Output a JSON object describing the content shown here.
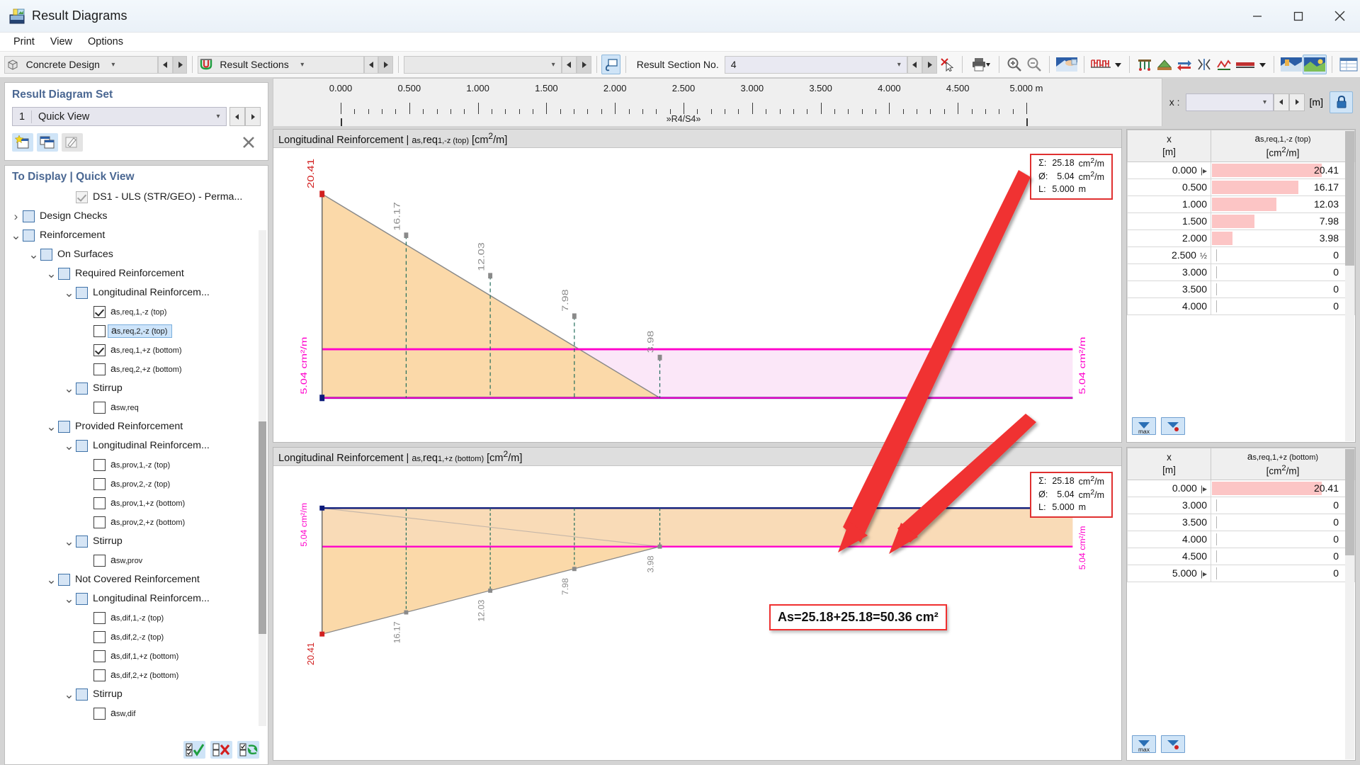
{
  "window": {
    "title": "Result Diagrams",
    "icon": "result-diagrams-icon",
    "minimize": "minimize",
    "maximize": "maximize",
    "close": "close"
  },
  "menu": {
    "items": [
      "Print",
      "View",
      "Options"
    ]
  },
  "toolbar": {
    "design_combo": {
      "value": "Concrete Design",
      "icon": "cube-icon"
    },
    "sections_combo": {
      "value": "Result Sections",
      "icon": "section-icon"
    },
    "empty_combo": {
      "value": ""
    },
    "snapshot_button": "snapshot",
    "result_section_label": "Result Section No.",
    "result_section_value": "4",
    "delete_button": "delete-cursor",
    "print_button": "print",
    "zoom_in_button": "zoom-in",
    "zoom_out_button": "zoom-out",
    "render_button": "render-view",
    "diagram_button": "diagram-style",
    "icons": [
      "result-values",
      "surface-results",
      "exchange",
      "scale",
      "line-style",
      "members",
      "solids",
      "table-view"
    ]
  },
  "xcontrol": {
    "label": "x :",
    "value": "",
    "unit": "[m]",
    "lock": "lock-icon"
  },
  "ruler": {
    "ticks": [
      "0.000",
      "0.500",
      "1.000",
      "1.500",
      "2.000",
      "2.500",
      "3.000",
      "3.500",
      "4.000",
      "4.500",
      "5.000 m"
    ],
    "section_label": "»R4/S4»"
  },
  "sidebar": {
    "set_header": "Result Diagram Set",
    "set_number": "1",
    "set_name": "Quick View",
    "set_buttons": [
      "new-set-icon",
      "copy-set-icon",
      "edit-set-icon",
      "close-icon"
    ],
    "display_header": "To Display | Quick View",
    "tree": [
      {
        "indent": 3,
        "twist": "",
        "box": "gray-checked",
        "label": "DS1 - ULS (STR/GEO) - Perma...",
        "sel": false
      },
      {
        "indent": 0,
        "twist": "right",
        "box": "parent",
        "label": "Design Checks",
        "sel": false
      },
      {
        "indent": 0,
        "twist": "down",
        "box": "parent",
        "label": "Reinforcement",
        "sel": false
      },
      {
        "indent": 1,
        "twist": "down",
        "box": "parent",
        "label": "On Surfaces",
        "sel": false
      },
      {
        "indent": 2,
        "twist": "down",
        "box": "parent",
        "label": "Required Reinforcement",
        "sel": false
      },
      {
        "indent": 3,
        "twist": "down",
        "box": "parent",
        "label": "Longitudinal Reinforcem...",
        "sel": false
      },
      {
        "indent": 4,
        "twist": "",
        "box": "leaf-checked",
        "label": "as,req,1,-z (top)",
        "sel": false
      },
      {
        "indent": 4,
        "twist": "",
        "box": "leaf",
        "label": "as,req,2,-z (top)",
        "sel": true
      },
      {
        "indent": 4,
        "twist": "",
        "box": "leaf-checked",
        "label": "as,req,1,+z (bottom)",
        "sel": false
      },
      {
        "indent": 4,
        "twist": "",
        "box": "leaf",
        "label": "as,req,2,+z (bottom)",
        "sel": false
      },
      {
        "indent": 3,
        "twist": "down",
        "box": "parent",
        "label": "Stirrup",
        "sel": false
      },
      {
        "indent": 4,
        "twist": "",
        "box": "leaf",
        "label": "asw,req",
        "sel": false
      },
      {
        "indent": 2,
        "twist": "down",
        "box": "parent",
        "label": "Provided Reinforcement",
        "sel": false
      },
      {
        "indent": 3,
        "twist": "down",
        "box": "parent",
        "label": "Longitudinal Reinforcem...",
        "sel": false
      },
      {
        "indent": 4,
        "twist": "",
        "box": "leaf",
        "label": "as,prov,1,-z (top)",
        "sel": false
      },
      {
        "indent": 4,
        "twist": "",
        "box": "leaf",
        "label": "as,prov,2,-z (top)",
        "sel": false
      },
      {
        "indent": 4,
        "twist": "",
        "box": "leaf",
        "label": "as,prov,1,+z (bottom)",
        "sel": false
      },
      {
        "indent": 4,
        "twist": "",
        "box": "leaf",
        "label": "as,prov,2,+z (bottom)",
        "sel": false
      },
      {
        "indent": 3,
        "twist": "down",
        "box": "parent",
        "label": "Stirrup",
        "sel": false
      },
      {
        "indent": 4,
        "twist": "",
        "box": "leaf",
        "label": "asw,prov",
        "sel": false
      },
      {
        "indent": 2,
        "twist": "down",
        "box": "parent",
        "label": "Not Covered Reinforcement",
        "sel": false
      },
      {
        "indent": 3,
        "twist": "down",
        "box": "parent",
        "label": "Longitudinal Reinforcem...",
        "sel": false
      },
      {
        "indent": 4,
        "twist": "",
        "box": "leaf",
        "label": "as,dif,1,-z (top)",
        "sel": false
      },
      {
        "indent": 4,
        "twist": "",
        "box": "leaf",
        "label": "as,dif,2,-z (top)",
        "sel": false
      },
      {
        "indent": 4,
        "twist": "",
        "box": "leaf",
        "label": "as,dif,1,+z (bottom)",
        "sel": false
      },
      {
        "indent": 4,
        "twist": "",
        "box": "leaf",
        "label": "as,dif,2,+z (bottom)",
        "sel": false
      },
      {
        "indent": 3,
        "twist": "down",
        "box": "parent",
        "label": "Stirrup",
        "sel": false
      },
      {
        "indent": 4,
        "twist": "",
        "box": "leaf",
        "label": "asw,dif",
        "sel": false
      }
    ],
    "footer_buttons": [
      "select-all-icon",
      "deselect-all-icon",
      "invert-selection-icon"
    ]
  },
  "annotation": {
    "text": "As=25.18+25.18=50.36 cm²"
  },
  "colors": {
    "accent": "#4a6792",
    "diagram_fill": "#fbd9a9",
    "cover_fill": "#fbe3f6",
    "provided_line": "#ff00cc",
    "top_line": "#001a8c",
    "peak_red": "#d22020",
    "annot_red": "#f03030",
    "bar_pink": "#fcc5c5"
  },
  "chart_data": [
    {
      "type": "area",
      "title": "Longitudinal Reinforcement | as,req,1,-z (top) [cm2/m]",
      "xlabel": "x [m]",
      "ylabel": "as,req,1,-z (top) [cm2/m]",
      "x": [
        0.0,
        0.5,
        1.0,
        1.5,
        2.0,
        2.5,
        3.0,
        3.5,
        4.0,
        4.5,
        5.0
      ],
      "values": [
        20.41,
        16.17,
        12.03,
        7.98,
        3.98,
        0,
        0,
        0,
        0,
        0,
        0
      ],
      "labeled_points": [
        "20.41",
        "16.17",
        "12.03",
        "7.98",
        "3.98"
      ],
      "max_value": 20.41,
      "provided_level": 5.04,
      "provided_label": "5.04 cm2/m",
      "peak_label": "20.41",
      "xlim": [
        0,
        5
      ],
      "legend": {
        "sum_key": "Σ:",
        "sum_value": "25.18",
        "sum_unit": "cm2/m",
        "avg_key": "Ø:",
        "avg_value": "5.04",
        "avg_unit": "cm2/m",
        "len_key": "L:",
        "len_value": "5.000",
        "len_unit": "m"
      }
    },
    {
      "type": "area",
      "title": "Longitudinal Reinforcement | as,req,1,+z (bottom) [cm2/m]",
      "xlabel": "x [m]",
      "ylabel": "as,req,1,+z (bottom) [cm2/m]",
      "x": [
        0.0,
        0.5,
        1.0,
        1.5,
        2.0,
        2.5,
        3.0,
        3.5,
        4.0,
        4.5,
        5.0
      ],
      "values": [
        20.41,
        16.17,
        12.03,
        7.98,
        3.98,
        0,
        0,
        0,
        0,
        0,
        0
      ],
      "labeled_points": [
        "20.41",
        "16.17",
        "12.03",
        "7.98",
        "3.98"
      ],
      "max_value": 20.41,
      "provided_level": 5.04,
      "provided_label": "5.04 cm2/m",
      "peak_label": "20.41",
      "xlim": [
        0,
        5
      ],
      "legend": {
        "sum_key": "Σ:",
        "sum_value": "25.18",
        "sum_unit": "cm2/m",
        "avg_key": "Ø:",
        "avg_value": "5.04",
        "avg_unit": "cm2/m",
        "len_key": "L:",
        "len_value": "5.000",
        "len_unit": "m"
      }
    }
  ],
  "tables": [
    {
      "col_x_header": "x",
      "col_x_unit": "[m]",
      "col_v_header": "as,req,1,-z (top)",
      "col_v_unit": "[cm2/m]",
      "rows": [
        {
          "x": "0.000",
          "mark": "start",
          "value": "20.41",
          "bar": 100,
          "flags": [
            "gray",
            "blue"
          ]
        },
        {
          "x": "0.500",
          "mark": "",
          "value": "16.17",
          "bar": 79,
          "flags": []
        },
        {
          "x": "1.000",
          "mark": "",
          "value": "12.03",
          "bar": 59,
          "flags": []
        },
        {
          "x": "1.500",
          "mark": "",
          "value": "7.98",
          "bar": 39,
          "flags": []
        },
        {
          "x": "2.000",
          "mark": "",
          "value": "3.98",
          "bar": 19,
          "flags": []
        },
        {
          "x": "2.500",
          "mark": "half",
          "value": "0",
          "bar": 0,
          "flags": []
        },
        {
          "x": "3.000",
          "mark": "",
          "value": "0",
          "bar": 0,
          "flags": [
            "red",
            "gray"
          ]
        },
        {
          "x": "3.500",
          "mark": "",
          "value": "0",
          "bar": 0,
          "flags": [
            "red",
            "gray"
          ]
        },
        {
          "x": "4.000",
          "mark": "",
          "value": "0",
          "bar": 0,
          "flags": [
            "red",
            "gray"
          ]
        }
      ],
      "footer_buttons": [
        "max-filter-icon",
        "filter-icon"
      ],
      "max_label": "max"
    },
    {
      "col_x_header": "x",
      "col_x_unit": "[m]",
      "col_v_header": "as,req,1,+z (bottom)",
      "col_v_unit": "[cm2/m]",
      "rows": [
        {
          "x": "0.000",
          "mark": "start",
          "value": "20.41",
          "bar": 100,
          "flags": [
            "gray",
            "blue"
          ]
        },
        {
          "x": "3.000",
          "mark": "",
          "value": "0",
          "bar": 0,
          "flags": [
            "red",
            "gray"
          ]
        },
        {
          "x": "3.500",
          "mark": "",
          "value": "0",
          "bar": 0,
          "flags": [
            "red",
            "gray"
          ]
        },
        {
          "x": "4.000",
          "mark": "",
          "value": "0",
          "bar": 0,
          "flags": [
            "red",
            "gray"
          ]
        },
        {
          "x": "4.500",
          "mark": "",
          "value": "0",
          "bar": 0,
          "flags": [
            "red",
            "gray"
          ]
        },
        {
          "x": "5.000",
          "mark": "end",
          "value": "0",
          "bar": 0,
          "flags": [
            "red",
            "gray"
          ]
        }
      ],
      "footer_buttons": [
        "max-filter-icon",
        "filter-icon"
      ],
      "max_label": "max"
    }
  ]
}
